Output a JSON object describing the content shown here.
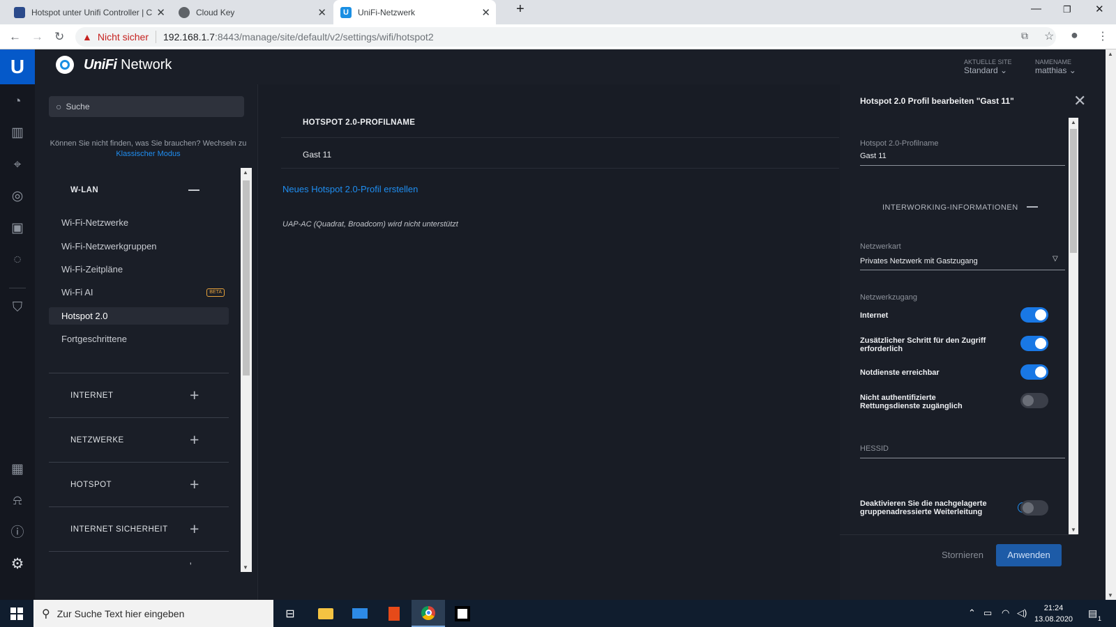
{
  "browser": {
    "tabs": [
      {
        "title": "Hotspot unter Unifi Controller | C",
        "icon": "cb-favicon"
      },
      {
        "title": "Cloud Key",
        "icon": "globe-favicon"
      },
      {
        "title": "UniFi-Netzwerk",
        "icon": "unifi-favicon"
      }
    ],
    "security_label": "Nicht sicher",
    "url_host": "192.168.1.7",
    "url_rest": ":8443/manage/site/default/v2/settings/wifi/hotspot2"
  },
  "header": {
    "brand_unifi": "UniFi",
    "brand_network": "Network",
    "site_label": "AKTUELLE SITE",
    "site_value": "Standard",
    "user_label": "NAMENAME",
    "user_value": "matthias"
  },
  "sidebar": {
    "search_placeholder": "Suche",
    "cant_find": "Können Sie nicht finden, was Sie brauchen? Wechseln zu",
    "classic_link": "Klassischer Modus",
    "wlan_heading": "W-LAN",
    "items": [
      {
        "label": "Wi-Fi-Netzwerke"
      },
      {
        "label": "Wi-Fi-Netzwerkgruppen"
      },
      {
        "label": "Wi-Fi-Zeitpläne"
      },
      {
        "label": "Wi-Fi AI",
        "badge": "BETA"
      },
      {
        "label": "Hotspot 2.0",
        "selected": true
      },
      {
        "label": "Fortgeschrittene"
      }
    ],
    "sections": [
      {
        "label": "INTERNET"
      },
      {
        "label": "NETZWERKE"
      },
      {
        "label": "HOTSPOT"
      },
      {
        "label": "INTERNET SICHERHEIT"
      }
    ]
  },
  "main": {
    "column_header": "HOTSPOT 2.0-PROFILNAME",
    "rows": [
      {
        "name": "Gast 11"
      }
    ],
    "create_link": "Neues Hotspot 2.0-Profil erstellen",
    "note": "UAP-AC (Quadrat, Broadcom) wird nicht unterstützt"
  },
  "panel": {
    "title": "Hotspot 2.0 Profil bearbeiten \"Gast 11\"",
    "profile_name_label": "Hotspot 2.0-Profilname",
    "profile_name_value": "Gast 11",
    "interworking_heading": "INTERWORKING-INFORMATIONEN",
    "network_type_label": "Netzwerkart",
    "network_type_value": "Privates Netzwerk mit Gastzugang",
    "network_access_label": "Netzwerkzugang",
    "toggles": [
      {
        "label": "Internet",
        "on": true
      },
      {
        "label": "Zusätzlicher Schritt für den Zugriff erforderlich",
        "on": true
      },
      {
        "label": "Notdienste erreichbar",
        "on": true
      },
      {
        "label": "Nicht authentifizierte Rettungsdienste zugänglich",
        "on": false
      }
    ],
    "hessid_label": "HESSID",
    "disable_forwarding_label": "Deaktivieren Sie die nachgelagerte gruppenadressierte Weiterleitung",
    "disable_forwarding_on": false,
    "cancel_label": "Stornieren",
    "apply_label": "Anwenden"
  },
  "taskbar": {
    "search_placeholder": "Zur Suche Text hier eingeben",
    "time": "21:24",
    "date": "13.08.2020",
    "notification_count": "1"
  },
  "colors": {
    "accent_blue": "#1f8ef1",
    "toggle_on": "#1978e5",
    "unifi_logo_bg": "#0559c9",
    "beta_badge": "#e7a23b",
    "not_secure_red": "#c5221f"
  }
}
